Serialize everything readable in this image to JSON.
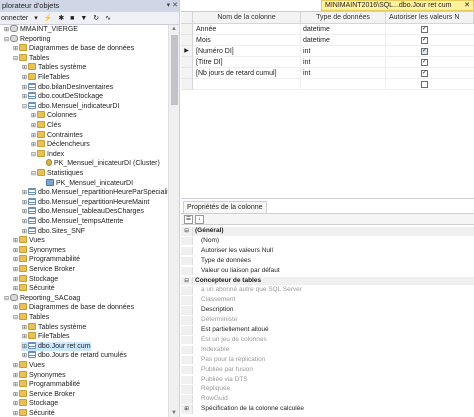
{
  "explorer": {
    "title": "plorateur d'objets",
    "title_controls": "▾ ✕",
    "toolbar": {
      "connect_label": "onnecter",
      "icons": [
        "connect-dropdown-icon",
        "connect-icon",
        "disconnect-icon",
        "filter-icon",
        "refresh-icon",
        "activity-icon"
      ]
    },
    "tree": [
      {
        "label": "MMAINT_VIERGE",
        "level": 1,
        "toggle": "+",
        "icon": "db"
      },
      {
        "label": "Reporting",
        "level": 1,
        "toggle": "-",
        "icon": "db"
      },
      {
        "label": "Diagrammes de base de données",
        "level": 2,
        "toggle": "+",
        "icon": "folder"
      },
      {
        "label": "Tables",
        "level": 2,
        "toggle": "-",
        "icon": "folder"
      },
      {
        "label": "Tables système",
        "level": 3,
        "toggle": "+",
        "icon": "folder"
      },
      {
        "label": "FileTables",
        "level": 3,
        "toggle": "+",
        "icon": "folder"
      },
      {
        "label": "dbo.bilanDesInventaires",
        "level": 3,
        "toggle": "+",
        "icon": "table"
      },
      {
        "label": "dbo.coutDeStockage",
        "level": 3,
        "toggle": "+",
        "icon": "table"
      },
      {
        "label": "dbo.Mensuel_indicateurDI",
        "level": 3,
        "toggle": "-",
        "icon": "table"
      },
      {
        "label": "Colonnes",
        "level": 4,
        "toggle": "+",
        "icon": "folder"
      },
      {
        "label": "Clés",
        "level": 4,
        "toggle": "+",
        "icon": "folder"
      },
      {
        "label": "Contraintes",
        "level": 4,
        "toggle": "+",
        "icon": "folder"
      },
      {
        "label": "Déclencheurs",
        "level": 4,
        "toggle": "+",
        "icon": "folder"
      },
      {
        "label": "Index",
        "level": 4,
        "toggle": "-",
        "icon": "folder"
      },
      {
        "label": "PK_Mensuel_inicateurDI (Cluster)",
        "level": 5,
        "toggle": "",
        "icon": "key"
      },
      {
        "label": "Statistiques",
        "level": 4,
        "toggle": "-",
        "icon": "folder"
      },
      {
        "label": "PK_Mensuel_inicateurDI",
        "level": 5,
        "toggle": "",
        "icon": "stat"
      },
      {
        "label": "dbo.Mensuel_repartitionHeureParSpecialite",
        "level": 3,
        "toggle": "+",
        "icon": "table"
      },
      {
        "label": "dbo.Mensuel_repartitionHeureMaint",
        "level": 3,
        "toggle": "+",
        "icon": "table"
      },
      {
        "label": "dbo.Mensuel_tableauDesCharges",
        "level": 3,
        "toggle": "+",
        "icon": "table"
      },
      {
        "label": "dbo.Mensuel_tempsAttente",
        "level": 3,
        "toggle": "+",
        "icon": "table"
      },
      {
        "label": "dbo.Sites_SNF",
        "level": 3,
        "toggle": "+",
        "icon": "table"
      },
      {
        "label": "Vues",
        "level": 2,
        "toggle": "+",
        "icon": "folder"
      },
      {
        "label": "Synonymes",
        "level": 2,
        "toggle": "+",
        "icon": "folder"
      },
      {
        "label": "Programmabilité",
        "level": 2,
        "toggle": "+",
        "icon": "folder"
      },
      {
        "label": "Service Broker",
        "level": 2,
        "toggle": "+",
        "icon": "folder"
      },
      {
        "label": "Stockage",
        "level": 2,
        "toggle": "+",
        "icon": "folder"
      },
      {
        "label": "Sécurité",
        "level": 2,
        "toggle": "+",
        "icon": "folder"
      },
      {
        "label": "Reporting_SACoag",
        "level": 1,
        "toggle": "-",
        "icon": "db"
      },
      {
        "label": "Diagrammes de base de données",
        "level": 2,
        "toggle": "+",
        "icon": "folder"
      },
      {
        "label": "Tables",
        "level": 2,
        "toggle": "-",
        "icon": "folder"
      },
      {
        "label": "Tables système",
        "level": 3,
        "toggle": "+",
        "icon": "folder"
      },
      {
        "label": "FileTables",
        "level": 3,
        "toggle": "+",
        "icon": "folder"
      },
      {
        "label": "dbo.Jour ret cum",
        "level": 3,
        "toggle": "+",
        "icon": "table",
        "selected": true
      },
      {
        "label": "dbo.Jours de retard cumulés",
        "level": 3,
        "toggle": "+",
        "icon": "table"
      },
      {
        "label": "Vues",
        "level": 2,
        "toggle": "+",
        "icon": "folder"
      },
      {
        "label": "Synonymes",
        "level": 2,
        "toggle": "+",
        "icon": "folder"
      },
      {
        "label": "Programmabilité",
        "level": 2,
        "toggle": "+",
        "icon": "folder"
      },
      {
        "label": "Service Broker",
        "level": 2,
        "toggle": "+",
        "icon": "folder"
      },
      {
        "label": "Stockage",
        "level": 2,
        "toggle": "+",
        "icon": "folder"
      },
      {
        "label": "Sécurité",
        "level": 2,
        "toggle": "+",
        "icon": "folder"
      }
    ]
  },
  "designer": {
    "tab_title": "MINIMAINT2016\\SQL...dbo.Jour ret cum",
    "tab_close": "✕",
    "columns_header": {
      "name": "Nom de la colonne",
      "type": "Type de données",
      "nulls": "Autoriser les valeurs N"
    },
    "rows": [
      {
        "name": "Année",
        "type": "datetime",
        "nullable": true
      },
      {
        "name": "Mois",
        "type": "datetime",
        "nullable": true
      },
      {
        "name": "[Numéro DI]",
        "type": "int",
        "nullable": true,
        "current": true
      },
      {
        "name": "[Titre DI]",
        "type": "int",
        "nullable": true
      },
      {
        "name": "[Nb jours de retard cumul]",
        "type": "int",
        "nullable": true
      },
      {
        "name": "",
        "type": "",
        "nullable": false
      }
    ],
    "current_row_marker": "▶"
  },
  "properties": {
    "tab_label": "Propriétés de la colonne",
    "toolbar_icons": [
      "categorized-icon",
      "alphabetical-icon"
    ],
    "rows": [
      {
        "label": "(Général)",
        "kind": "cat",
        "gut": "⊟"
      },
      {
        "label": "(Nom)",
        "kind": "item"
      },
      {
        "label": "Autoriser les valeurs Null",
        "kind": "item"
      },
      {
        "label": "Type de données",
        "kind": "item"
      },
      {
        "label": "Valeur ou liaison par défaut",
        "kind": "item"
      },
      {
        "label": "Concepteur de tables",
        "kind": "cat",
        "gut": "⊟"
      },
      {
        "label": "a un abonné autre que SQL Server",
        "kind": "dis"
      },
      {
        "label": "Classement",
        "kind": "dis"
      },
      {
        "label": "Description",
        "kind": "item"
      },
      {
        "label": "Déterministe",
        "kind": "dis"
      },
      {
        "label": "Est partiellement alloué",
        "kind": "item"
      },
      {
        "label": "Est un jeu de colonnes",
        "kind": "dis"
      },
      {
        "label": "Indexable",
        "kind": "dis"
      },
      {
        "label": "Pas pour la réplication",
        "kind": "dis"
      },
      {
        "label": "Publiée par fusion",
        "kind": "dis"
      },
      {
        "label": "Publiée via DTS",
        "kind": "dis"
      },
      {
        "label": "Répliquée",
        "kind": "dis"
      },
      {
        "label": "RowGuid",
        "kind": "dis"
      },
      {
        "label": "Spécification de la colonne calculée",
        "kind": "item",
        "gut": "⊞"
      }
    ]
  }
}
